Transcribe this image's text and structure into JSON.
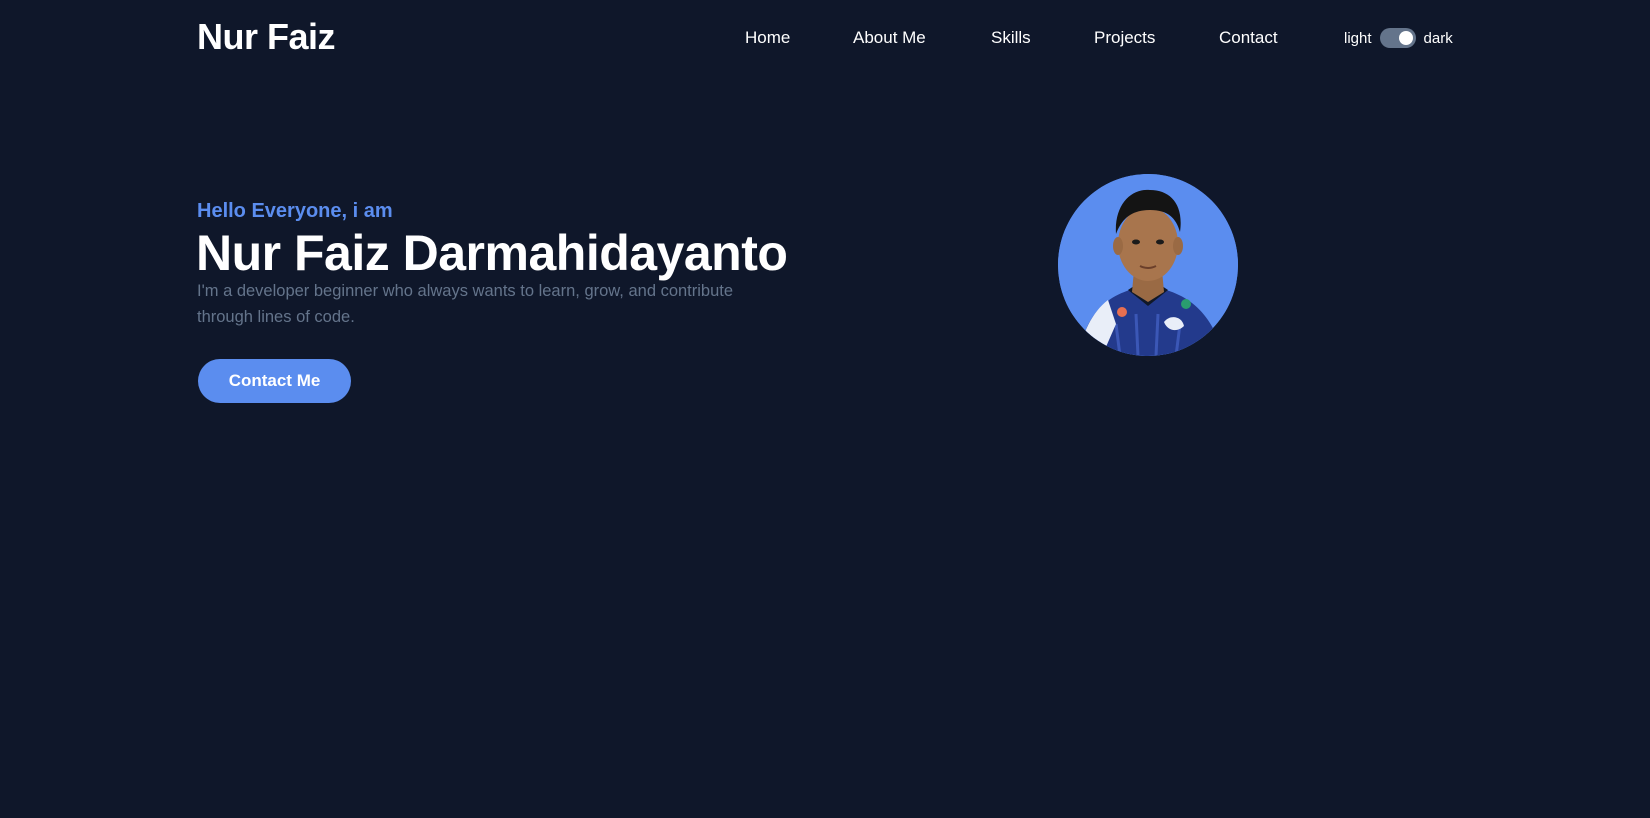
{
  "header": {
    "logo": "Nur Faiz",
    "nav": [
      {
        "label": "Home"
      },
      {
        "label": "About Me"
      },
      {
        "label": "Skills"
      },
      {
        "label": "Projects"
      },
      {
        "label": "Contact"
      }
    ],
    "theme": {
      "light_label": "light",
      "dark_label": "dark",
      "mode": "dark"
    }
  },
  "hero": {
    "greeting": "Hello Everyone, i am",
    "name": "Nur Faiz Darmahidayanto",
    "description": "I'm a developer beginner who always wants to learn, grow, and contribute through lines of code.",
    "cta_label": "Contact Me"
  },
  "colors": {
    "background": "#0f172a",
    "accent": "#5b8def",
    "muted_text": "#64748b",
    "text": "#ffffff"
  }
}
